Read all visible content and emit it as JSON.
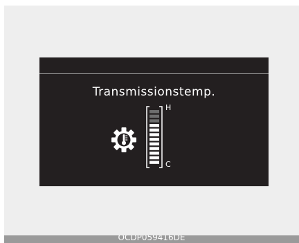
{
  "screen": {
    "title": "Transmissionstemp.",
    "icon": "transmission-temperature-icon",
    "gauge": {
      "high_label": "H",
      "low_label": "C",
      "total_segments": 12,
      "lit_segments": 9,
      "lit_color": "#ffffff",
      "unlit_color": "#6e6e6e"
    }
  },
  "footer": {
    "code": "OCDP059416DE"
  }
}
